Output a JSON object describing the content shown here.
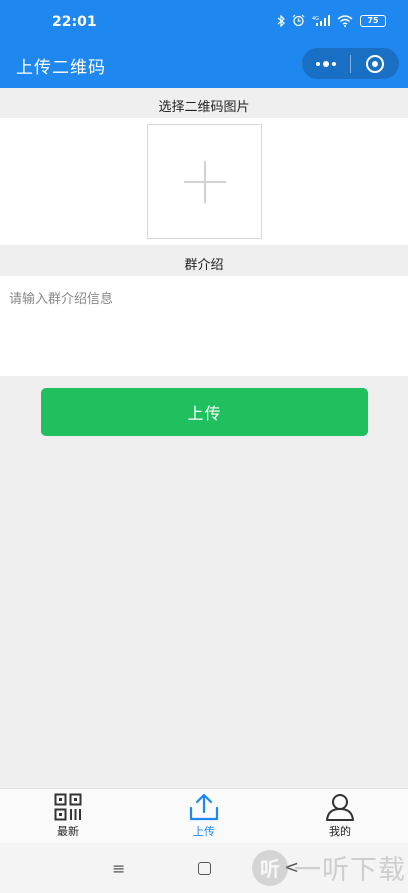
{
  "status_bar": {
    "time": "22:01",
    "battery": "75"
  },
  "title_bar": {
    "title": "上传二维码"
  },
  "qr_section": {
    "label": "选择二维码图片"
  },
  "intro_section": {
    "label": "群介绍",
    "placeholder": "请输入群介绍信息",
    "value": ""
  },
  "upload_button": {
    "label": "上传"
  },
  "tabs": [
    {
      "label": "最新",
      "icon": "qrcode-icon",
      "active": false
    },
    {
      "label": "上传",
      "icon": "upload-icon",
      "active": true
    },
    {
      "label": "我的",
      "icon": "user-icon",
      "active": false
    }
  ],
  "system_nav": {
    "menu_glyph": "≡",
    "back_glyph": "<"
  },
  "watermark": {
    "logo_glyph": "听",
    "text": "一听下载"
  },
  "colors": {
    "primary": "#1f88f0",
    "button": "#21c05f",
    "background": "#efefef"
  }
}
